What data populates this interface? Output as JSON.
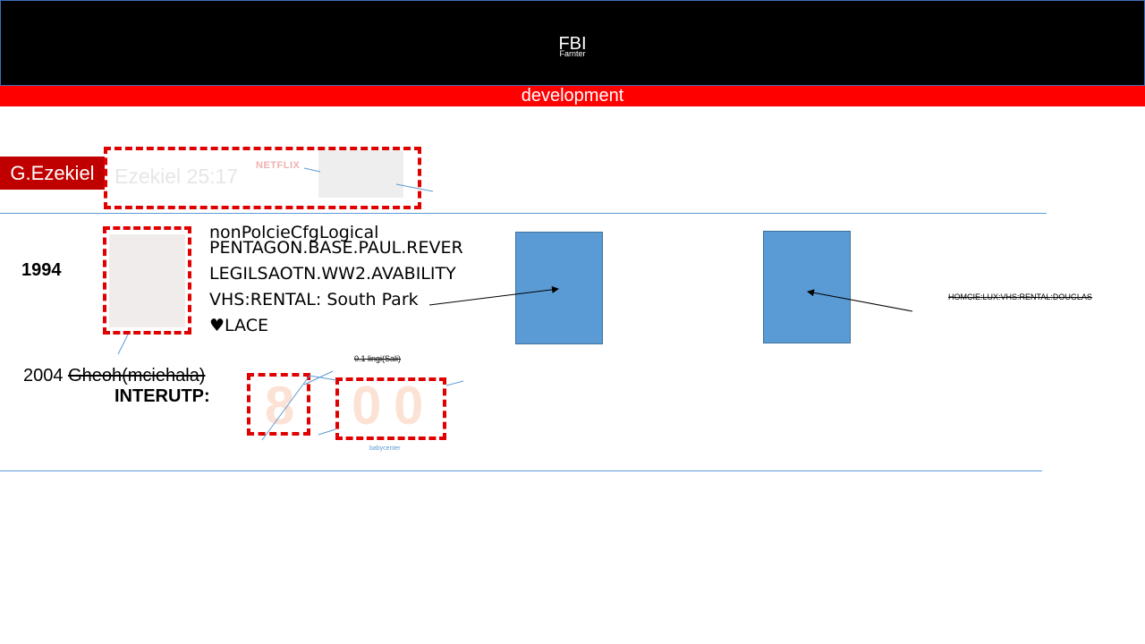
{
  "header": {
    "title": "FBI",
    "subtitle": "Farnter",
    "banner": "development"
  },
  "colors": {
    "header_bg": "#000000",
    "banner_bg": "#ff0000",
    "badge_bg": "#c00000",
    "box_fill": "#5b9bd5",
    "dashed_border": "#e00000"
  },
  "top_row": {
    "badge": "G.Ezekiel",
    "verse": "Ezekiel 25:17",
    "logo_text": "NETFLIX"
  },
  "middle_row": {
    "year": "1994",
    "lines": [
      "nonPolcieCfgLogical",
      "PENTAGON.BASE.PAUL.REVER",
      "LEGILSAOTN.WW2.AVABILITY",
      "VHS:RENTAL: South Park",
      "♥LACE"
    ],
    "right_note": "HOMCIE:LUX:VHS:RENTAL:DOUGLAS"
  },
  "bottom_row": {
    "year": "2004",
    "struck_name": "Gheoh(mciehala)",
    "label": "INTERUTP:",
    "small_note": "0.1 lingi(Sali)",
    "digits": [
      "8",
      "0",
      "0"
    ],
    "caption": "babycenter"
  }
}
